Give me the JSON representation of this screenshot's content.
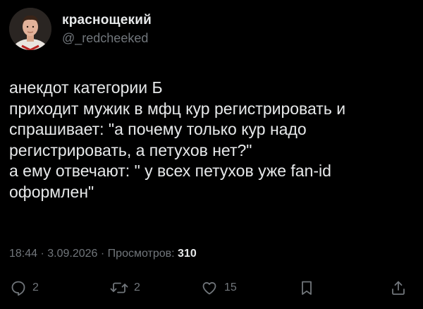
{
  "author": {
    "display_name": "краснощекий",
    "handle": "@_redcheeked",
    "avatar_icon": "profile-photo"
  },
  "tweet": {
    "lines": [
      "анекдот категории Б",
      "приходит мужик в мфц кур регистрировать и",
      "спрашивает: \"а почему только кур надо",
      "регистрировать, а петухов нет?\"",
      "а ему отвечают: \" у всех петухов уже fan-id",
      "оформлен\""
    ]
  },
  "meta": {
    "time": "18:44",
    "separator": " · ",
    "date": "3.09.2026",
    "views_label": "Просмотров:",
    "views_count": "310"
  },
  "actions": {
    "reply": {
      "icon": "reply-icon",
      "count": "2"
    },
    "retweet": {
      "icon": "retweet-icon",
      "count": "2"
    },
    "like": {
      "icon": "heart-icon",
      "count": "15"
    },
    "bookmark": {
      "icon": "bookmark-icon"
    },
    "share": {
      "icon": "share-icon"
    }
  },
  "colors": {
    "background": "#000000",
    "text_primary": "#e7e9ea",
    "text_secondary": "#71767b"
  }
}
